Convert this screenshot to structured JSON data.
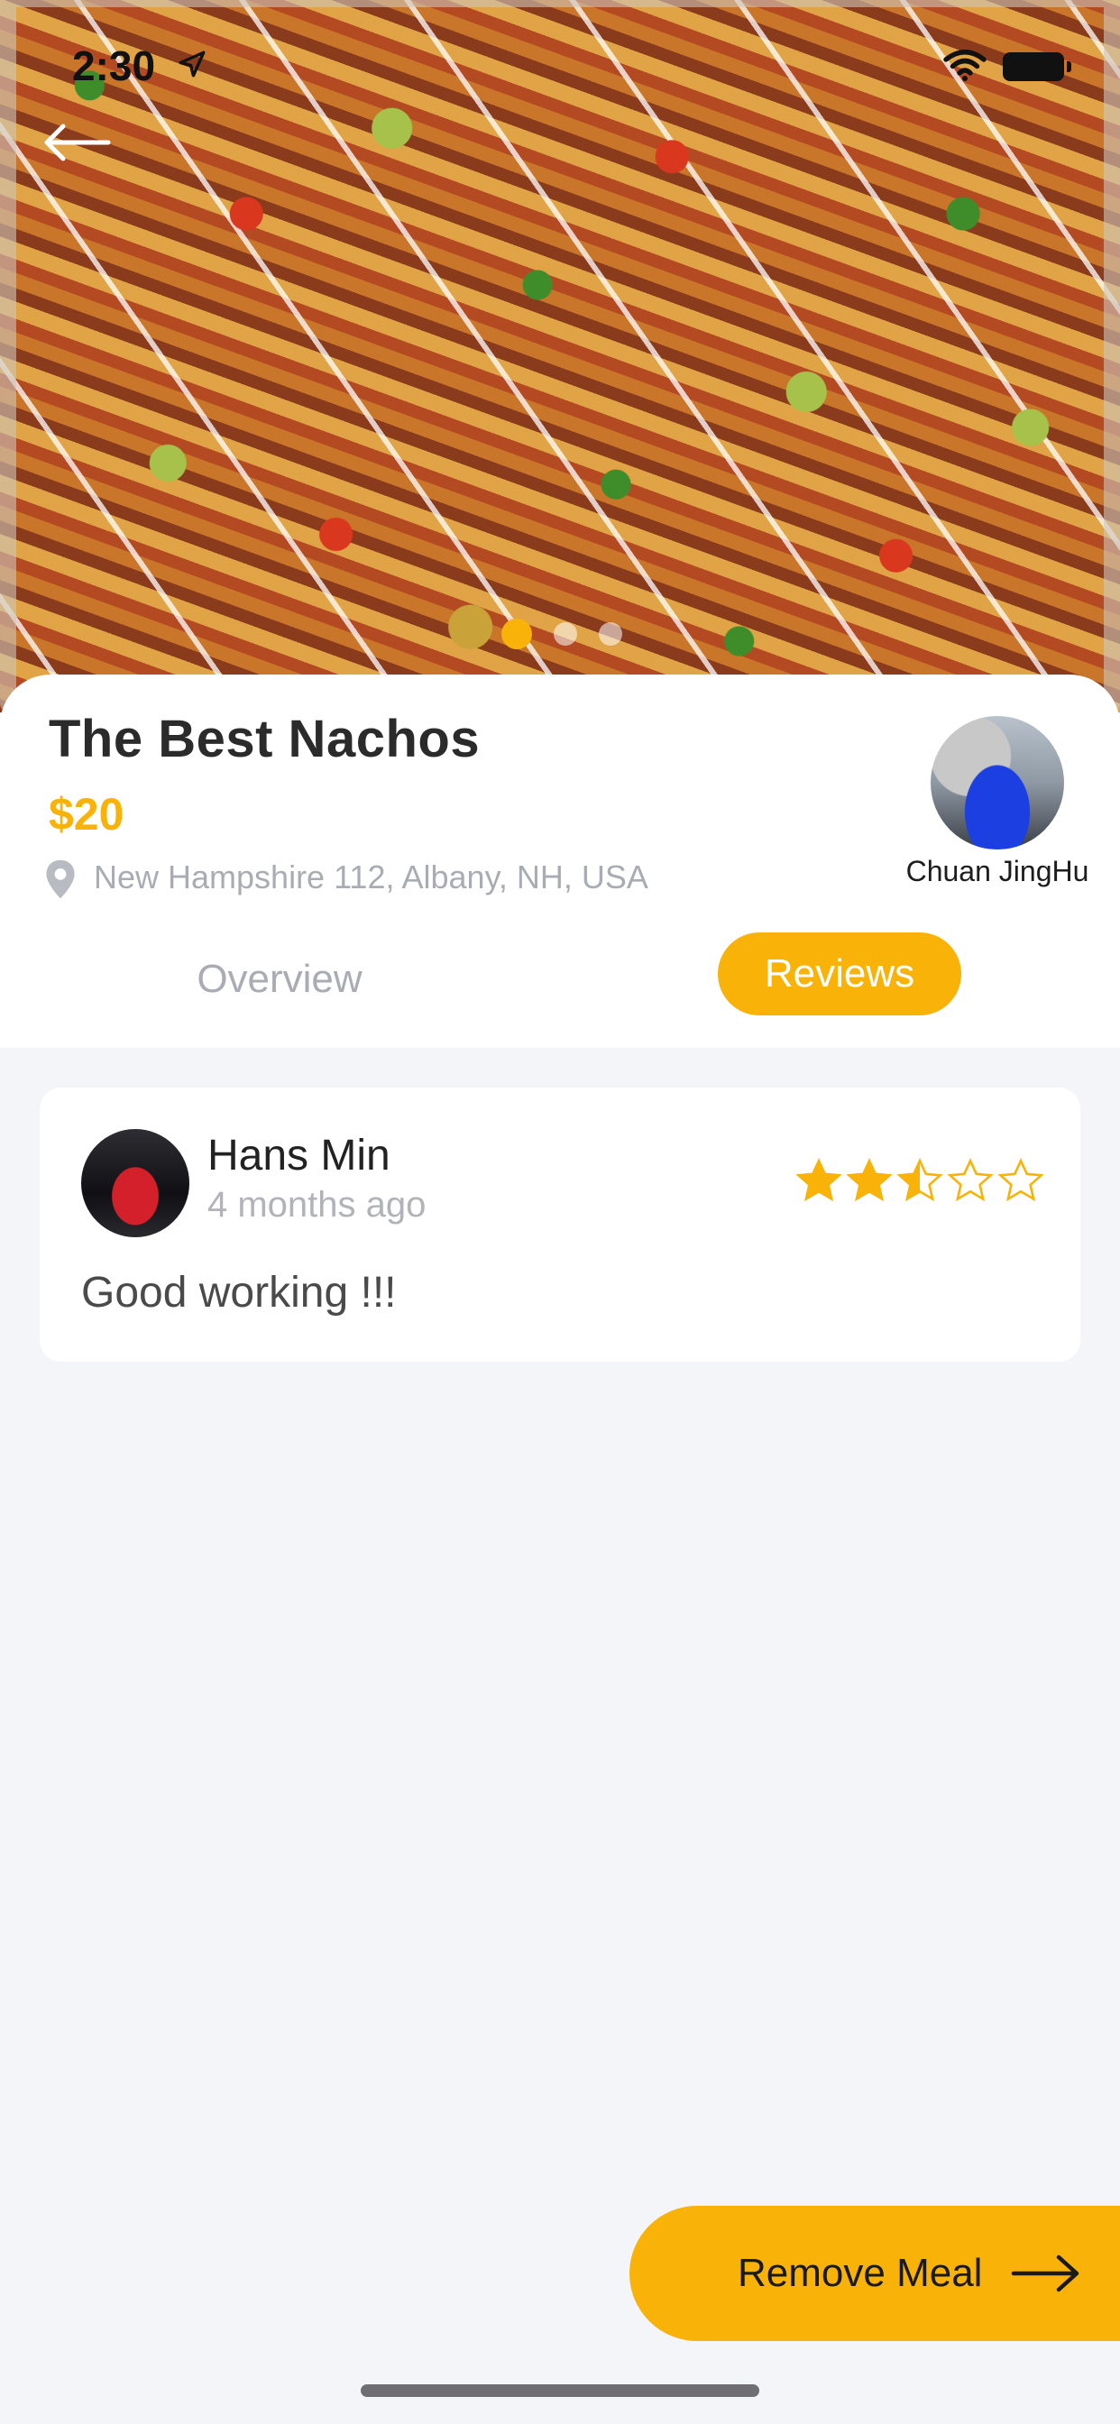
{
  "status_bar": {
    "time": "2:30",
    "icons": [
      "location-arrow-icon",
      "wifi-icon",
      "battery-icon"
    ]
  },
  "header": {
    "back_icon": "arrow-left-icon",
    "carousel_dots": 3,
    "carousel_active_index": 0
  },
  "meal": {
    "title": "The Best Nachos",
    "price": "$20",
    "address": "New Hampshire 112, Albany, NH, USA",
    "address_icon": "location-pin-icon"
  },
  "chef": {
    "name": "Chuan JingHu"
  },
  "tabs": {
    "overview": "Overview",
    "reviews": "Reviews",
    "active": "reviews"
  },
  "reviews": [
    {
      "name": "Hans Min",
      "time": "4 months ago",
      "rating": 2.5,
      "rating_max": 5,
      "text": "Good working !!!"
    }
  ],
  "actions": {
    "remove_meal_label": "Remove Meal",
    "remove_meal_icon": "arrow-right-icon"
  },
  "colors": {
    "accent": "#f9b208",
    "background": "#f4f5f9",
    "card": "#ffffff",
    "muted_text": "#a9acb3"
  }
}
